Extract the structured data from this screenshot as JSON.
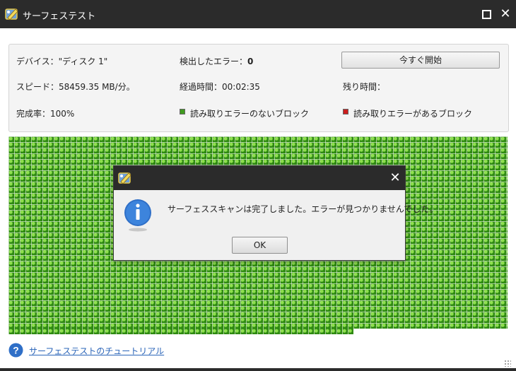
{
  "window": {
    "title": "サーフェステスト",
    "icon": "surface-test-app-icon",
    "maximize_icon": "maximize-icon",
    "close_icon": "close-icon"
  },
  "info": {
    "device_label": "デバイス：\"ディスク 1\"",
    "errors_label": "検出したエラー：",
    "errors_value": "0",
    "start_button": "今すぐ開始",
    "speed_label": "スピード：58459.35 MB/分。",
    "elapsed_label": "経過時間：00:02:35",
    "remaining_label": "残り時間：",
    "completion_label": "完成率：100%",
    "legend_ok": "読み取りエラーのないブロック",
    "legend_error": "読み取りエラーがあるブロック"
  },
  "colors": {
    "titlebar": "#2b2b2b",
    "ok_block": "#3f9a1f",
    "error_block": "#cc1d1d",
    "link": "#2a64b8"
  },
  "block_grid": {
    "status": "all blocks read without error",
    "progress": 1.0
  },
  "dialog": {
    "icon": "info-icon",
    "message": "サーフェススキャンは完了しました。エラーが見つかりませんでした。",
    "ok_button": "OK"
  },
  "footer": {
    "help_icon": "question-icon",
    "tutorial_link": "サーフェステストのチュートリアル"
  }
}
